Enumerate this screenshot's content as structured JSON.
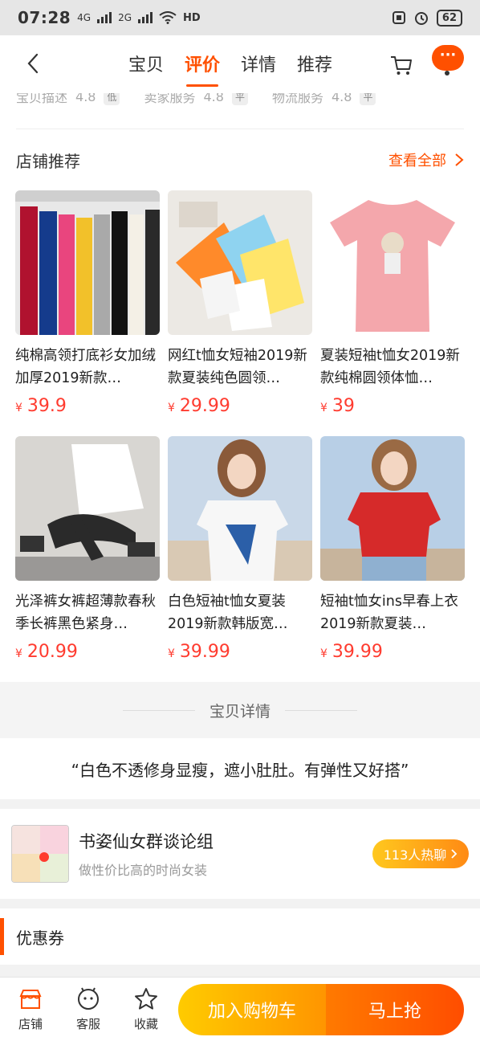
{
  "status_bar": {
    "time": "07:28",
    "network_1": "4G",
    "network_2": "2G",
    "hd": "HD",
    "battery": "62"
  },
  "nav": {
    "tabs": [
      "宝贝",
      "评价",
      "详情",
      "推荐"
    ],
    "active_tab": "评价",
    "more_label": "···"
  },
  "ratings": [
    {
      "label": "宝贝描述",
      "score": "4.8",
      "level": "低"
    },
    {
      "label": "卖家服务",
      "score": "4.8",
      "level": "平"
    },
    {
      "label": "物流服务",
      "score": "4.8",
      "level": "平"
    }
  ],
  "recommend": {
    "title": "店铺推荐",
    "see_all": "查看全部",
    "items": [
      {
        "name": "纯棉高领打底衫女加绒加厚2019新款…",
        "currency": "¥",
        "price": "39.9"
      },
      {
        "name": "网红t恤女短袖2019新款夏装纯色圆领…",
        "currency": "¥",
        "price": "29.99"
      },
      {
        "name": "夏装短袖t恤女2019新款纯棉圆领体恤…",
        "currency": "¥",
        "price": "39"
      },
      {
        "name": "光泽裤女裤超薄款春秋季长裤黑色紧身…",
        "currency": "¥",
        "price": "20.99"
      },
      {
        "name": "白色短袖t恤女夏装2019新款韩版宽…",
        "currency": "¥",
        "price": "39.99"
      },
      {
        "name": "短袖t恤女ins早春上衣2019新款夏装…",
        "currency": "¥",
        "price": "39.99"
      }
    ]
  },
  "detail": {
    "title": "宝贝详情",
    "quote": "“白色不透修身显瘦，遮小肚肚。有弹性又好搭”"
  },
  "group": {
    "name": "书姿仙女群谈论组",
    "subtitle": "做性价比高的时尚女装",
    "hot": "113人热聊"
  },
  "coupon": {
    "title": "优惠券"
  },
  "bottom_bar": {
    "shop": "店铺",
    "service": "客服",
    "favorite": "收藏",
    "add_cart": "加入购物车",
    "buy_now": "马上抢"
  },
  "colors": {
    "accent": "#ff5000",
    "price": "#ff3b2f"
  }
}
